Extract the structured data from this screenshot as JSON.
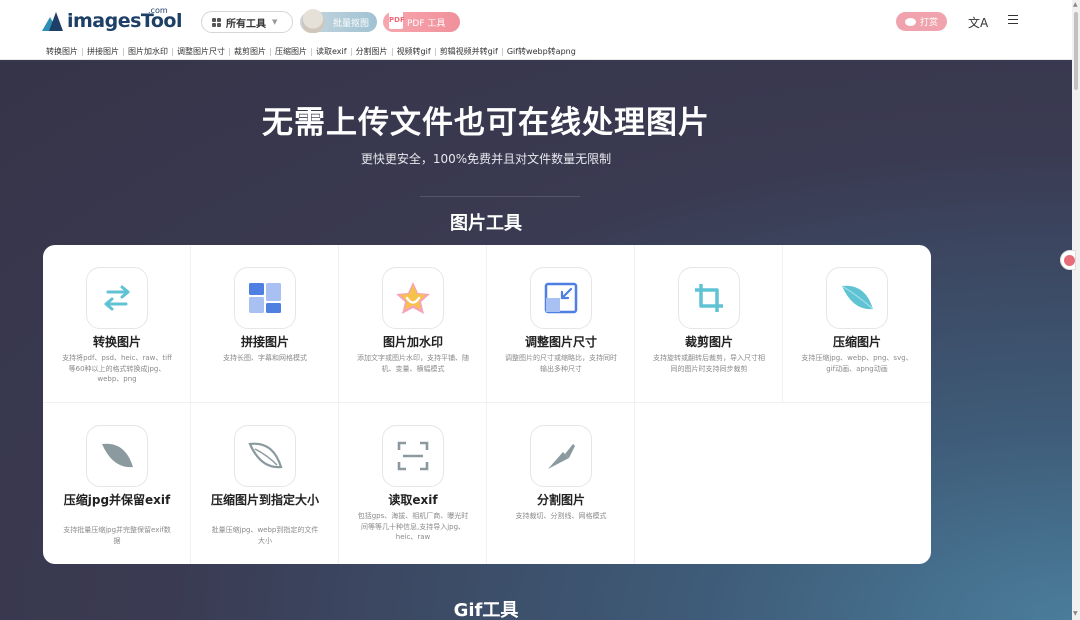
{
  "header": {
    "logo_text": "imagesTool",
    "logo_com": ".com",
    "all_tools": "所有工具",
    "batch_button": "批量抠图",
    "pdf_button": "PDF 工具",
    "pdf_icon_text": "PDF",
    "tip_button": "打赏",
    "lang_icon": "translate-icon",
    "menu_icon": "hamburger-icon"
  },
  "subnav": [
    "转换图片",
    "拼接图片",
    "图片加水印",
    "调整图片尺寸",
    "裁剪图片",
    "压缩图片",
    "读取exif",
    "分割图片",
    "视频转gif",
    "剪辑视频并转gif",
    "Gif转webp转apng"
  ],
  "hero": {
    "title": "无需上传文件也可在线处理图片",
    "subtitle": "更快更安全，100%免费并且对文件数量无限制"
  },
  "sections": {
    "image_tools": "图片工具",
    "gif_tools": "Gif工具"
  },
  "tools": [
    {
      "name": "转换图片",
      "desc": "支持将pdf、psd、heic、raw、tiff等60种以上的格式转换成jpg、webp、png",
      "icon": "swap-arrows-icon"
    },
    {
      "name": "拼接图片",
      "desc": "支持长图、字幕和网格模式",
      "icon": "layout-grid-icon"
    },
    {
      "name": "图片加水印",
      "desc": "添加文字或图片水印，支持平铺、随机、变量、横幅模式",
      "icon": "star-watermark-icon"
    },
    {
      "name": "调整图片尺寸",
      "desc": "调整图片的尺寸或缩略比，支持同时输出多种尺寸",
      "icon": "resize-icon"
    },
    {
      "name": "裁剪图片",
      "desc": "支持旋转或翻转后裁剪，导入尺寸相同的图片时支持同步裁剪",
      "icon": "crop-icon"
    },
    {
      "name": "压缩图片",
      "desc": "支持压缩jpg、webp、png、svg、gif动画、apng动画",
      "icon": "leaf-icon"
    },
    {
      "name": "压缩jpg并保留exif",
      "desc": "支持批量压缩jpg并完整保留exif数据",
      "icon": "leaf-gray-icon"
    },
    {
      "name": "压缩图片到指定大小",
      "desc": "批量压缩jpg、webp到指定的文件大小",
      "icon": "leaf-outline-icon"
    },
    {
      "name": "读取exif",
      "desc": "包括gps、海拔、相机厂商、曝光时间等等几十种信息,支持导入jpg、heic、raw",
      "icon": "scan-icon"
    },
    {
      "name": "分割图片",
      "desc": "支持裁切、分割线、网格模式",
      "icon": "knife-icon"
    }
  ],
  "colors": {
    "accent_pink": "#f0a3ac",
    "brand_blue": "#1e3f66",
    "icon_teal": "#5fc3d3"
  }
}
